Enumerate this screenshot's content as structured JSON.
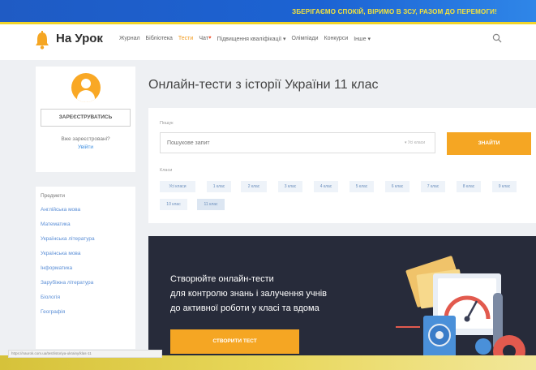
{
  "topbar": {
    "banner_text": "ЗБЕРІГАЄМО СПОКІЙ, ВІРИМО В ЗСУ, РАЗОМ ДО ПЕРЕМОГИ!"
  },
  "header": {
    "logo_text": "На Урок",
    "nav": [
      "Журнал",
      "Бібліотека",
      "Тести",
      "Чат",
      "Підвищення кваліфікації ▾",
      "Олімпіади",
      "Конкурси",
      "Інше ▾"
    ],
    "active_nav": "Тести"
  },
  "sidebar": {
    "register_label": "ЗАРЕЄСТРУВАТИСЬ",
    "already_text": "Вже зареєстровані?",
    "login_label": "Увійти",
    "subjects_title": "Предмети",
    "subjects": [
      "Англійська мова",
      "Математика",
      "Українська література",
      "Українська мова",
      "Інформатика",
      "Зарубіжна література",
      "Біологія",
      "Географія"
    ]
  },
  "main": {
    "title": "Онлайн-тести з історії України 11 клас",
    "search_label": "Пошук",
    "search_placeholder": "Пошукове запит",
    "search_hint": "▾ Усі класи",
    "find_label": "ЗНАЙТИ",
    "class_label": "Класи",
    "classes": [
      "Усі класи",
      "1 клас",
      "2 клас",
      "3 клас",
      "4 клас",
      "5 клас",
      "6 клас",
      "7 клас",
      "8 клас",
      "9 клас",
      "10 клас",
      "11 клас"
    ],
    "selected_class": "11 клас"
  },
  "banner": {
    "lines": [
      "Створюйте онлайн-тести",
      "для контролю знань і залучення учнів",
      "до активної роботи у класі та вдома"
    ],
    "button_label": "СТВОРИТИ ТЕСТ"
  },
  "status": {
    "url_text": "https://naurok.com.ua/test/istoriya-ukrainy/klas-11"
  },
  "colors": {
    "accent": "#f5a623",
    "top_bar": "#1f5bc4",
    "banner_bg": "#272b3a"
  }
}
